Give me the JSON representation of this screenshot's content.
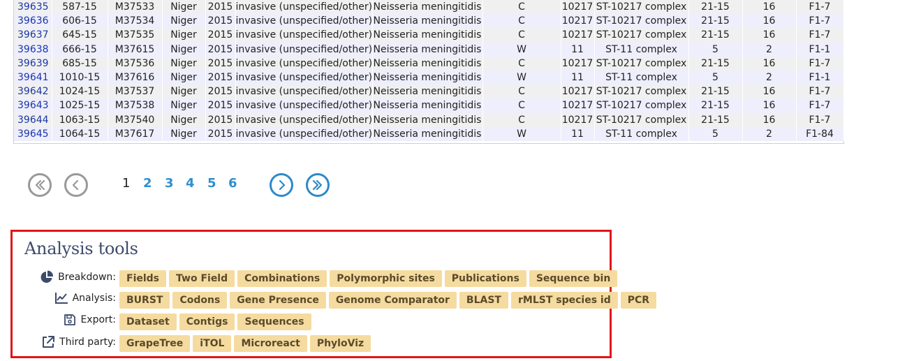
{
  "results": {
    "rows": [
      [
        "39635",
        "587-15",
        "M37533",
        "Niger",
        "2015",
        "invasive (unspecified/other)",
        "Neisseria meningitidis",
        "C",
        "10217",
        "ST-10217 complex",
        "21-15",
        "16",
        "F1-7"
      ],
      [
        "39636",
        "606-15",
        "M37534",
        "Niger",
        "2015",
        "invasive (unspecified/other)",
        "Neisseria meningitidis",
        "C",
        "10217",
        "ST-10217 complex",
        "21-15",
        "16",
        "F1-7"
      ],
      [
        "39637",
        "645-15",
        "M37535",
        "Niger",
        "2015",
        "invasive (unspecified/other)",
        "Neisseria meningitidis",
        "C",
        "10217",
        "ST-10217 complex",
        "21-15",
        "16",
        "F1-7"
      ],
      [
        "39638",
        "666-15",
        "M37615",
        "Niger",
        "2015",
        "invasive (unspecified/other)",
        "Neisseria meningitidis",
        "W",
        "11",
        "ST-11 complex",
        "5",
        "2",
        "F1-1"
      ],
      [
        "39639",
        "685-15",
        "M37536",
        "Niger",
        "2015",
        "invasive (unspecified/other)",
        "Neisseria meningitidis",
        "C",
        "10217",
        "ST-10217 complex",
        "21-15",
        "16",
        "F1-7"
      ],
      [
        "39641",
        "1010-15",
        "M37616",
        "Niger",
        "2015",
        "invasive (unspecified/other)",
        "Neisseria meningitidis",
        "W",
        "11",
        "ST-11 complex",
        "5",
        "2",
        "F1-1"
      ],
      [
        "39642",
        "1024-15",
        "M37537",
        "Niger",
        "2015",
        "invasive (unspecified/other)",
        "Neisseria meningitidis",
        "C",
        "10217",
        "ST-10217 complex",
        "21-15",
        "16",
        "F1-7"
      ],
      [
        "39643",
        "1025-15",
        "M37538",
        "Niger",
        "2015",
        "invasive (unspecified/other)",
        "Neisseria meningitidis",
        "C",
        "10217",
        "ST-10217 complex",
        "21-15",
        "16",
        "F1-7"
      ],
      [
        "39644",
        "1063-15",
        "M37540",
        "Niger",
        "2015",
        "invasive (unspecified/other)",
        "Neisseria meningitidis",
        "C",
        "10217",
        "ST-10217 complex",
        "21-15",
        "16",
        "F1-7"
      ],
      [
        "39645",
        "1064-15",
        "M37617",
        "Niger",
        "2015",
        "invasive (unspecified/other)",
        "Neisseria meningitidis",
        "W",
        "11",
        "ST-11 complex",
        "5",
        "2",
        "F1-84"
      ]
    ]
  },
  "pagination": {
    "first_icon": "double-chevron-left-icon",
    "prev_icon": "chevron-left-icon",
    "next_icon": "chevron-right-icon",
    "last_icon": "double-chevron-right-icon",
    "current_page": "1",
    "pages": [
      "1",
      "2",
      "3",
      "4",
      "5",
      "6"
    ]
  },
  "analysis_tools": {
    "title": "Analysis tools",
    "rows": [
      {
        "label": "Breakdown:",
        "icon": "pie-chart-icon",
        "buttons": [
          "Fields",
          "Two Field",
          "Combinations",
          "Polymorphic sites",
          "Publications",
          "Sequence bin"
        ]
      },
      {
        "label": "Analysis:",
        "icon": "line-chart-icon",
        "buttons": [
          "BURST",
          "Codons",
          "Gene Presence",
          "Genome Comparator",
          "BLAST",
          "rMLST species id",
          "PCR"
        ]
      },
      {
        "label": "Export:",
        "icon": "save-icon",
        "buttons": [
          "Dataset",
          "Contigs",
          "Sequences"
        ]
      },
      {
        "label": "Third party:",
        "icon": "external-link-icon",
        "buttons": [
          "GrapeTree",
          "iTOL",
          "Microreact",
          "PhyloViz"
        ]
      }
    ]
  },
  "colors": {
    "link": "#1a36a8",
    "pager_active": "#2c8ac9",
    "pager_inactive": "#999999",
    "button_bg": "#f5dba0",
    "highlight_border": "#e0151b"
  }
}
